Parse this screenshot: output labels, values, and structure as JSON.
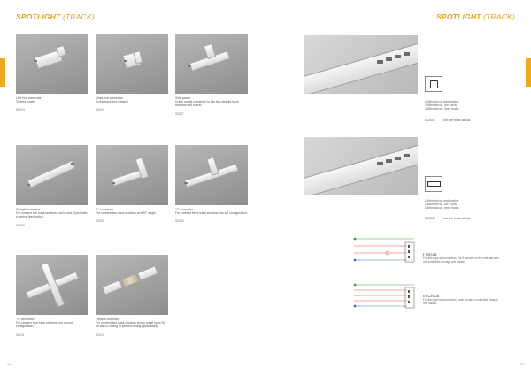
{
  "header": {
    "left": {
      "title": "SPOTLIGHT",
      "subtitle": " (TRACK)"
    },
    "right": {
      "title": "SPOTLIGHT",
      "subtitle": " (TRACK)"
    }
  },
  "pages": {
    "left_number": "14",
    "right_number": "15"
  },
  "products": [
    {
      "name": "Live end connector",
      "desc": "To feed power",
      "code": "SD003"
    },
    {
      "name": "Dead-end connector",
      "desc": "To the track end (closed)",
      "code": "SD004"
    },
    {
      "name": "Side power",
      "desc": "In line profile connector to join two straight track sections end to end",
      "code": "SD007"
    },
    {
      "name": "Straight connector",
      "desc": "For connect two track sections end to end. It provides a central feed option.",
      "code": "SD008"
    },
    {
      "name": "\"L\" connector",
      "desc": "For connect two track sections at a 90° angle.",
      "code": "SD009"
    },
    {
      "name": "\"T\" connector",
      "desc": "For connect three track sections into a T configuration.",
      "code": "SD010"
    },
    {
      "name": "\"X\" connector",
      "desc": "For connect four track sections into a cross configuration.",
      "code": "SD011"
    },
    {
      "name": "Flexible connector",
      "desc": "For connect two track sections at any angle up to 90 on wall to ceiling or pitched ceiling applications.",
      "code": "SD012"
    }
  ],
  "tracks": [
    {
      "specs": [
        "1 Wired circuit track tracks",
        "2 Wired circuit, live tracks",
        "3 Wired circuit, three tracks"
      ],
      "code": "SD001",
      "name": "Four line track actual"
    },
    {
      "specs": [
        "1 Wired circuit track tracks",
        "2 Wired circuit, live tracks",
        "3 Wired circuit, three tracks"
      ],
      "code": "SD002",
      "name": "Four line track actual"
    }
  ],
  "circuits": [
    {
      "name": "I-Circuit",
      "desc": "For this type of connection, the 3 circuits on the external sets are controlled through one switch."
    },
    {
      "name": "III-Circuit",
      "desc": "For this type of connection, each circuit is controlled through one switch."
    }
  ],
  "colors": {
    "accent": "#e8a317",
    "tab": "#f0a81c",
    "wire_red": "#d9534f",
    "wire_blue": "#3b78c4",
    "wire_green": "#4a9a48"
  }
}
